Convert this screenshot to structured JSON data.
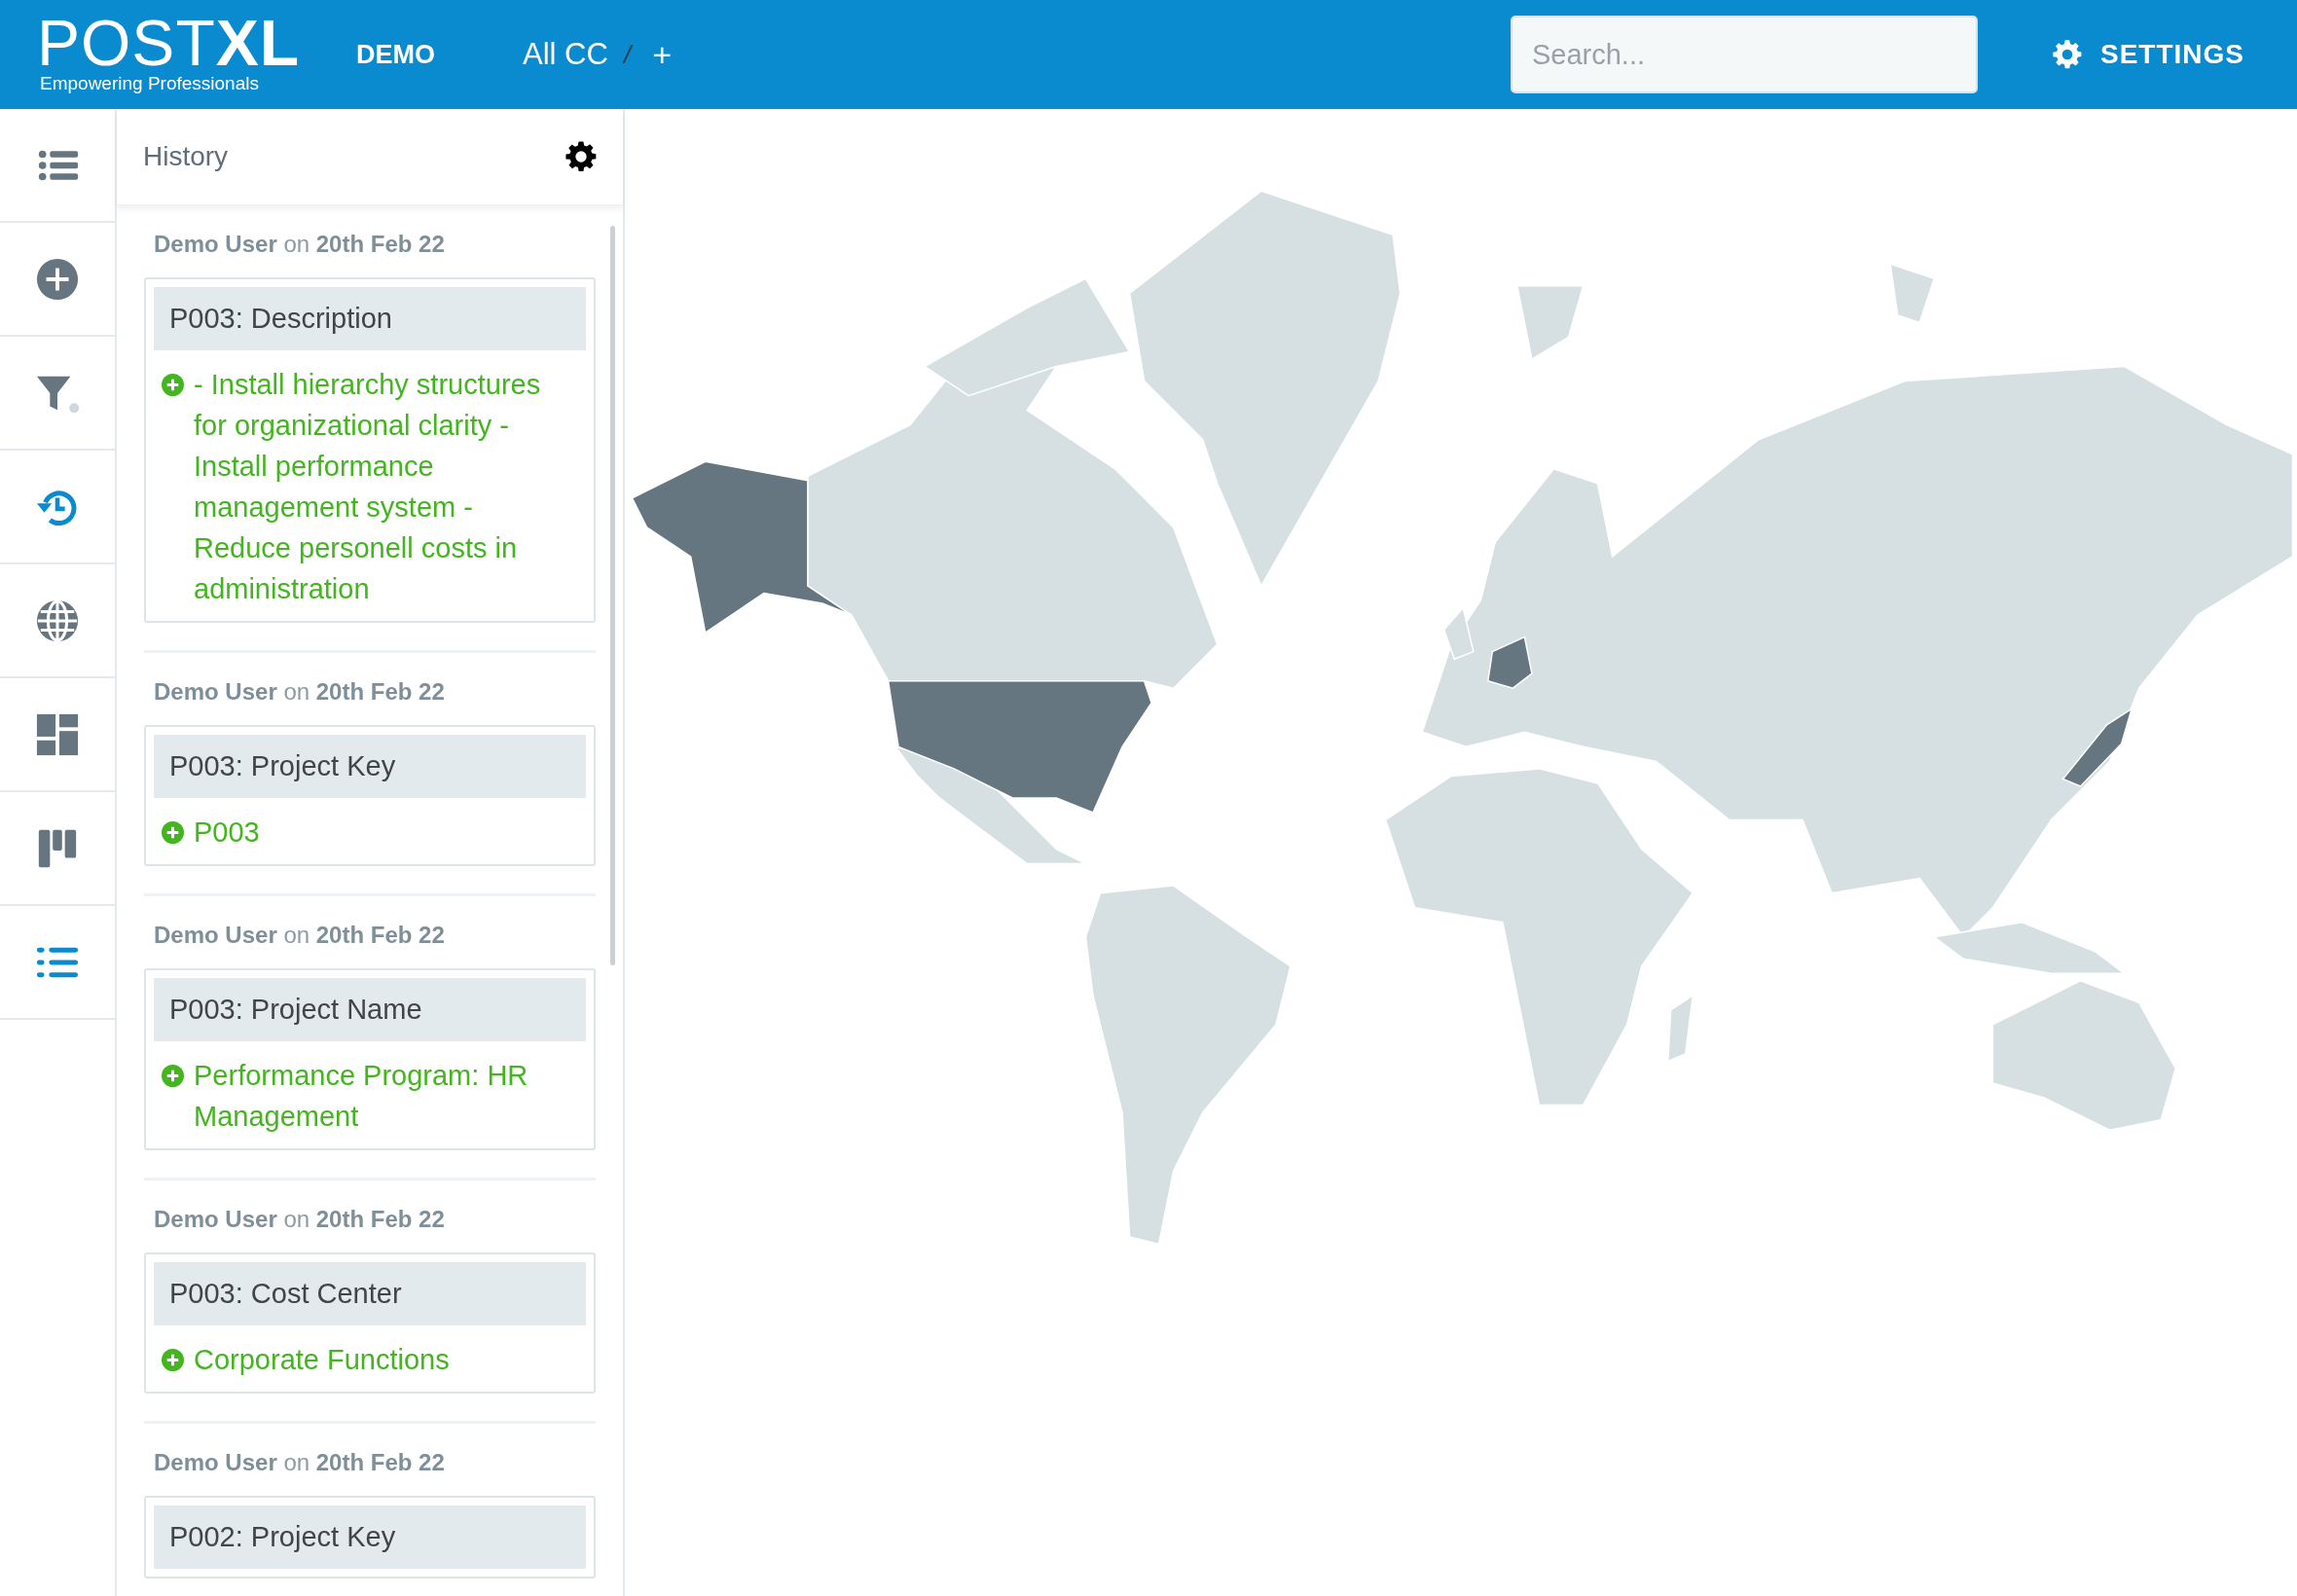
{
  "header": {
    "logo": "POST**XL**",
    "tagline": "Empowering Professionals",
    "nav": [
      {
        "label": "DEMO",
        "selected": true
      }
    ],
    "breadcrumb": {
      "label": "All CC",
      "separator": "/",
      "add": "+"
    },
    "search": {
      "placeholder": "Search..."
    },
    "settings": "SETTINGS"
  },
  "rail": [
    {
      "kind": "list",
      "active": false
    },
    {
      "kind": "add",
      "active": false
    },
    {
      "kind": "filter",
      "active": false
    },
    {
      "kind": "history",
      "active": true
    },
    {
      "kind": "globe",
      "active": false
    },
    {
      "kind": "dashboard",
      "active": false
    },
    {
      "kind": "board",
      "active": false
    },
    {
      "kind": "bullets",
      "active": true
    }
  ],
  "history": {
    "title": "History",
    "entries": [
      {
        "author": "**Demo User** on **20th Feb 22**",
        "field": "P003: Description",
        "kind": "added",
        "value": "- Install hierarchy structures for organizational clarity - Install performance management system - Reduce personell costs in administration"
      },
      {
        "author": "**Demo User** on **20th Feb 22**",
        "field": "P003: Project Key",
        "kind": "added",
        "value": "P003"
      },
      {
        "author": "**Demo User** on **20th Feb 22**",
        "field": "P003: Project Name",
        "kind": "added",
        "value": "Performance Program: HR Management"
      },
      {
        "author": "**Demo User** on **20th Feb 22**",
        "field": "P003: Cost Center",
        "kind": "added",
        "value": "Corporate Functions"
      },
      {
        "author": "**Demo User** on **20th Feb 22**",
        "field": "P002: Project Key"
      }
    ]
  }
}
